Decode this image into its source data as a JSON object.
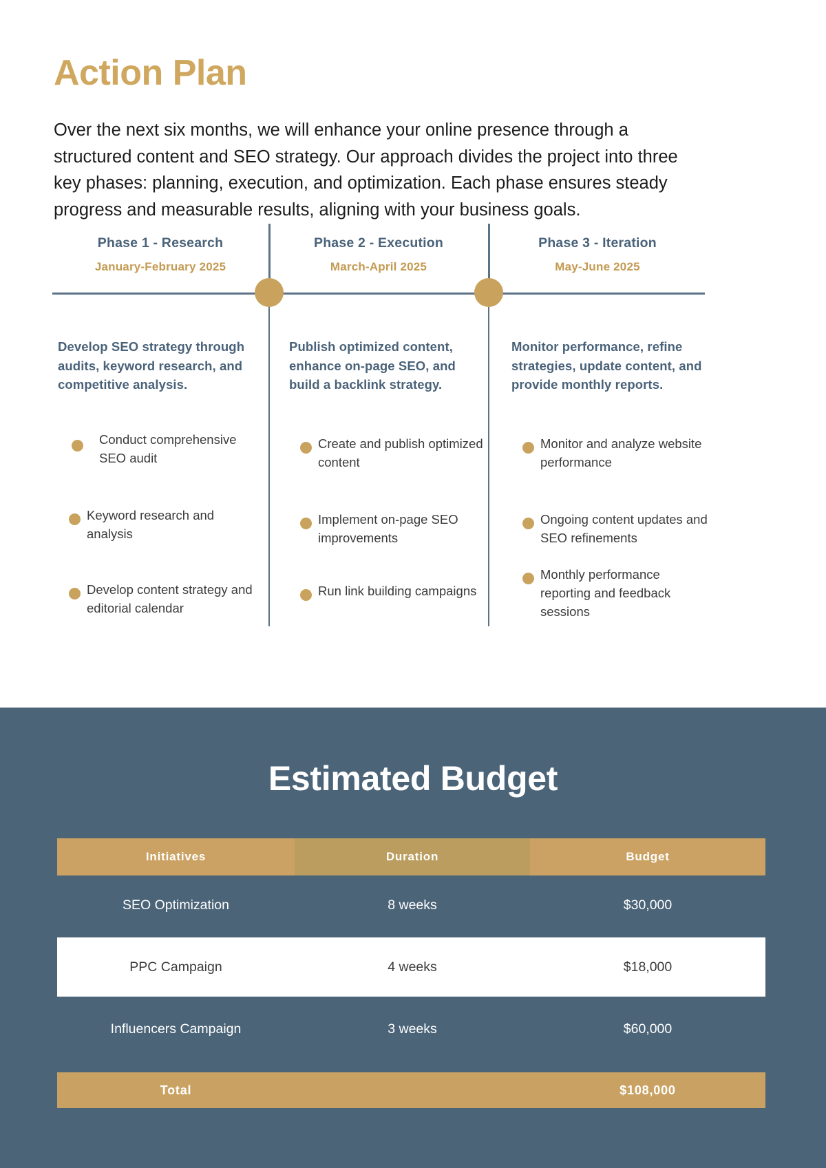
{
  "header": {
    "title": "Action Plan",
    "intro": "Over the next six months, we will enhance your online presence through a structured content and SEO strategy. Our approach divides the project into three key phases: planning, execution, and optimization. Each phase ensures steady progress and measurable results, aligning with your business goals."
  },
  "timeline": {
    "phases": [
      {
        "title": "Phase 1 - Research",
        "date": "January-February 2025",
        "description": "Develop SEO strategy through audits, keyword research, and competitive analysis.",
        "bullets": [
          "Conduct comprehensive SEO audit",
          "Keyword research and analysis",
          "Develop content strategy and editorial calendar"
        ]
      },
      {
        "title": "Phase 2 - Execution",
        "date": "March-April 2025",
        "description": "Publish optimized content, enhance on-page SEO, and build a backlink strategy.",
        "bullets": [
          "Create and publish optimized content",
          "Implement on-page SEO improvements",
          "Run link building campaigns"
        ]
      },
      {
        "title": "Phase 3 - Iteration",
        "date": "May-June 2025",
        "description": "Monitor performance, refine strategies, update content, and provide monthly reports.",
        "bullets": [
          "Monitor and analyze website performance",
          "Ongoing content updates and SEO refinements",
          "Monthly performance reporting and feedback sessions"
        ]
      }
    ]
  },
  "budget": {
    "title": "Estimated Budget",
    "columns": [
      "Initiatives",
      "Duration",
      "Budget"
    ],
    "rows": [
      {
        "initiative": "SEO Optimization",
        "duration": "8 weeks",
        "amount": "$30,000"
      },
      {
        "initiative": "PPC Campaign",
        "duration": "4 weeks",
        "amount": "$18,000"
      },
      {
        "initiative": "Influencers Campaign",
        "duration": "3 weeks",
        "amount": "$60,000"
      }
    ],
    "total": {
      "label": "Total",
      "duration": "",
      "amount": "$108,000"
    }
  },
  "colors": {
    "gold": "#c9a35e",
    "slate": "#4c6478",
    "heading_gold": "#cfa75f",
    "text_dark": "#1c1c1c"
  }
}
